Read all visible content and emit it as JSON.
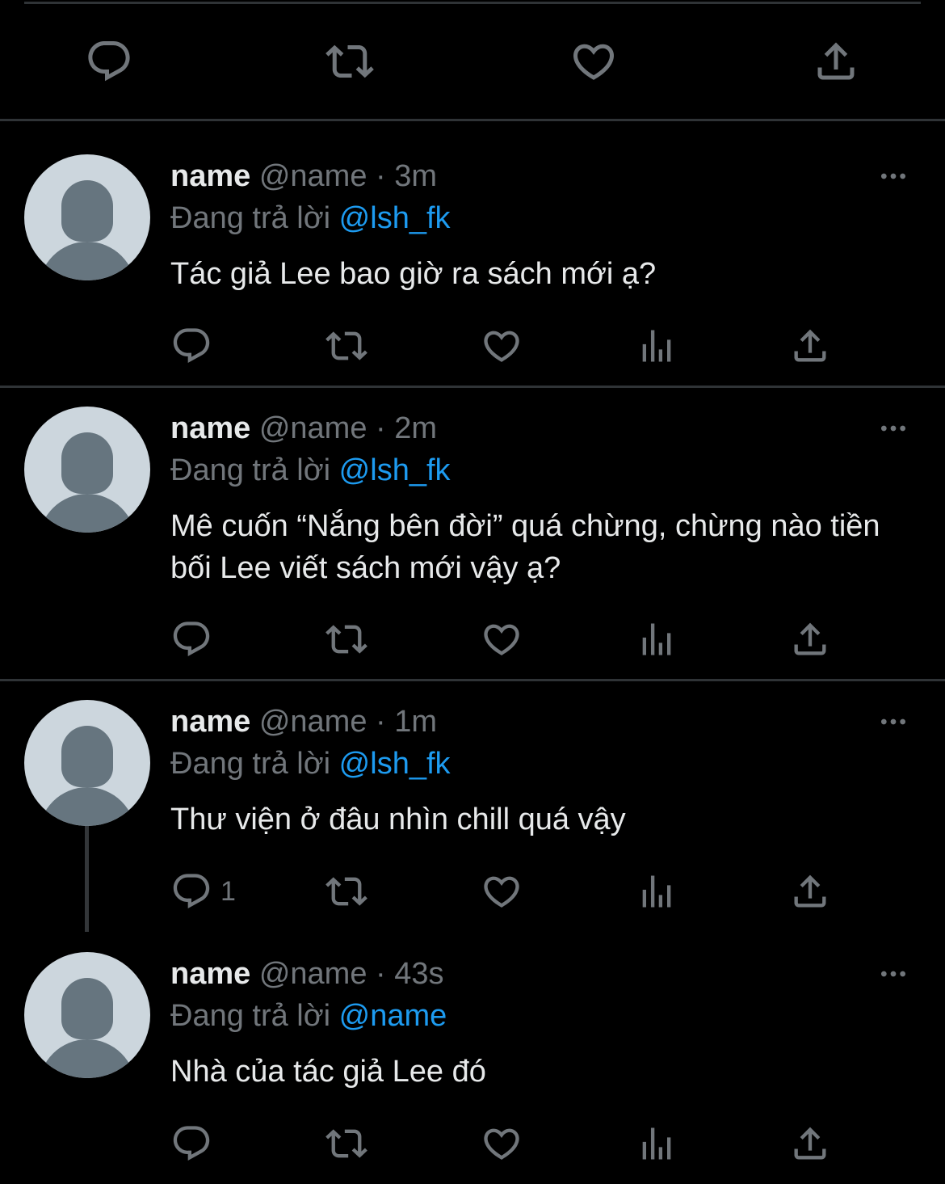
{
  "colors": {
    "background": "#000000",
    "text_primary": "#e7e9ea",
    "text_secondary": "#71767b",
    "accent": "#1d9bf0",
    "divider": "#2f3336",
    "avatar_bg": "#ccd6dd",
    "avatar_fg": "#66757f"
  },
  "top_actions": [
    "reply-icon",
    "retweet-icon",
    "like-icon",
    "share-icon"
  ],
  "tweets": [
    {
      "name": "name",
      "handle": "@name",
      "time": "· 3m",
      "reply_label": "Đang trả lời",
      "reply_to": "@lsh_fk",
      "text": "Tác giả Lee bao giờ ra sách mới ạ?",
      "reply_count": ""
    },
    {
      "name": "name",
      "handle": "@name",
      "time": "· 2m",
      "reply_label": "Đang trả lời",
      "reply_to": "@lsh_fk",
      "text": "Mê cuốn “Nắng bên đời” quá chừng, chừng nào tiền bối Lee viết sách mới vậy ạ?",
      "reply_count": ""
    },
    {
      "name": "name",
      "handle": "@name",
      "time": "· 1m",
      "reply_label": "Đang trả lời",
      "reply_to": "@lsh_fk",
      "text": "Thư viện ở đâu nhìn chill quá vậy",
      "reply_count": "1"
    },
    {
      "name": "name",
      "handle": "@name",
      "time": "· 43s",
      "reply_label": "Đang trả lời",
      "reply_to": "@name",
      "text": "Nhà của tác giả Lee đó",
      "reply_count": ""
    }
  ],
  "tweet_actions": [
    "reply-icon",
    "retweet-icon",
    "like-icon",
    "views-icon",
    "share-icon"
  ]
}
